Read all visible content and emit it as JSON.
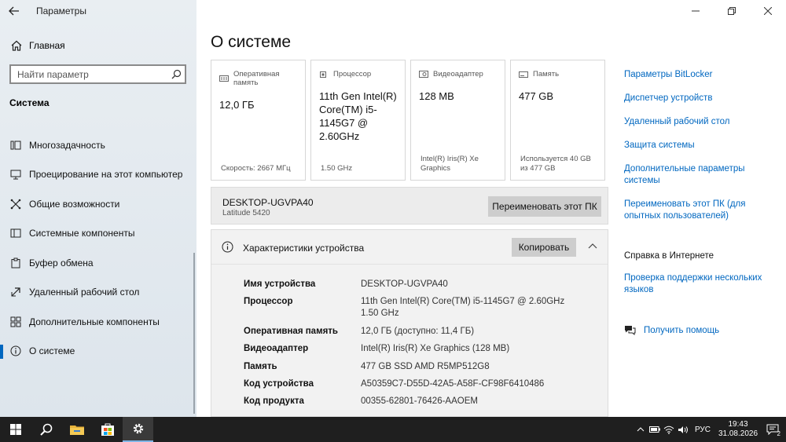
{
  "window": {
    "title": "Параметры"
  },
  "sidebar": {
    "home_label": "Главная",
    "search_placeholder": "Найти параметр",
    "section_title": "Система",
    "items": [
      {
        "label": "Многозадачность",
        "icon": "multitasking-icon"
      },
      {
        "label": "Проецирование на этот компьютер",
        "icon": "projecting-icon"
      },
      {
        "label": "Общие возможности",
        "icon": "shared-experiences-icon"
      },
      {
        "label": "Системные компоненты",
        "icon": "system-components-icon"
      },
      {
        "label": "Буфер обмена",
        "icon": "clipboard-icon"
      },
      {
        "label": "Удаленный рабочий стол",
        "icon": "remote-desktop-icon"
      },
      {
        "label": "Дополнительные компоненты",
        "icon": "optional-features-icon"
      },
      {
        "label": "О системе",
        "icon": "info-icon",
        "active": true
      }
    ]
  },
  "main": {
    "title": "О системе",
    "cards": [
      {
        "label": "Оперативная память",
        "value": "12,0 ГБ",
        "footer": "Скорость: 2667 МГц",
        "icon": "ram-icon"
      },
      {
        "label": "Процессор",
        "value": "11th Gen Intel(R) Core(TM) i5-1145G7 @ 2.60GHz",
        "footer": "1.50 GHz",
        "icon": "cpu-icon"
      },
      {
        "label": "Видеоадаптер",
        "value": "128 MB",
        "footer": "Intel(R) Iris(R) Xe Graphics",
        "icon": "gpu-icon"
      },
      {
        "label": "Память",
        "value": "477 GB",
        "footer": "Используется 40 GB из 477 GB",
        "icon": "storage-icon"
      }
    ],
    "device": {
      "name": "DESKTOP-UGVPA40",
      "model": "Latitude 5420",
      "rename_label": "Переименовать этот ПК"
    },
    "specs": {
      "title": "Характеристики устройства",
      "copy_label": "Копировать",
      "rows": [
        {
          "key": "Имя устройства",
          "value": "DESKTOP-UGVPA40"
        },
        {
          "key": "Процессор",
          "value": "11th Gen Intel(R) Core(TM) i5-1145G7 @ 2.60GHz 1.50 GHz"
        },
        {
          "key": "Оперативная память",
          "value": "12,0 ГБ (доступно: 11,4 ГБ)"
        },
        {
          "key": "Видеоадаптер",
          "value": "Intel(R) Iris(R) Xe Graphics (128 MB)"
        },
        {
          "key": "Память",
          "value": "477 GB SSD AMD R5MP512G8"
        },
        {
          "key": "Код устройства",
          "value": "A50359C7-D55D-42A5-A58F-CF98F6410486"
        },
        {
          "key": "Код продукта",
          "value": "00355-62801-76426-AAOEM"
        }
      ]
    }
  },
  "related": {
    "links": [
      "Параметры BitLocker",
      "Диспетчер устройств",
      "Удаленный рабочий стол",
      "Защита системы",
      "Дополнительные параметры системы",
      "Переименовать этот ПК (для опытных пользователей)"
    ],
    "help_title": "Справка в Интернете",
    "help_links": [
      "Проверка поддержки нескольких языков"
    ],
    "get_help": "Получить помощь"
  },
  "taskbar": {
    "lang": "РУС",
    "time": "19:43",
    "date": "31.08.2026",
    "notification_count": "2"
  },
  "colors": {
    "accent": "#0067c0",
    "taskbar": "#1f1f1f"
  }
}
